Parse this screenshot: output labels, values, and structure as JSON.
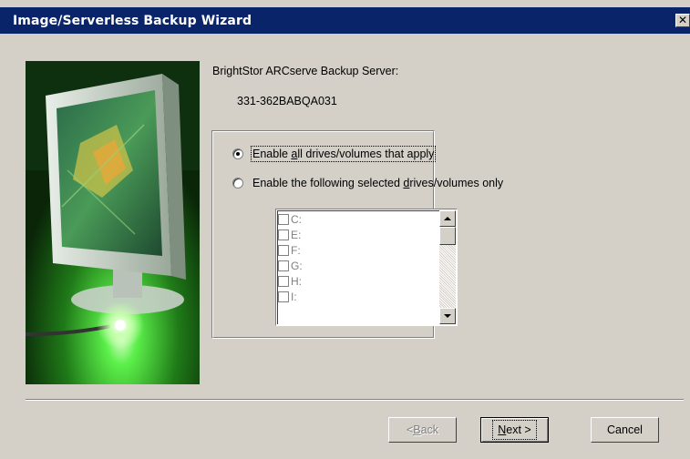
{
  "window": {
    "title": "Image/Serverless Backup Wizard",
    "close_glyph": "✕"
  },
  "server": {
    "label": "BrightStor ARCserve Backup Server:",
    "name": "331-362BABQA031"
  },
  "options": {
    "all": {
      "pre": "Enable ",
      "accel": "a",
      "post": "ll drives/volumes that apply",
      "checked": true
    },
    "selected": {
      "pre": "Enable the following selected ",
      "accel": "d",
      "post": "rives/volumes only",
      "checked": false
    }
  },
  "drives": [
    "C:",
    "E:",
    "F:",
    "G:",
    "H:",
    "I:"
  ],
  "buttons": {
    "back": {
      "pre": "< ",
      "accel": "B",
      "post": "ack"
    },
    "next": {
      "pre": "",
      "accel": "N",
      "post": "ext >"
    },
    "cancel": "Cancel"
  },
  "colors": {
    "titlebar": "#0a246a",
    "face": "#d4d0c8",
    "disabled_text": "#808080"
  },
  "icons": {
    "art": "monitor-illustration",
    "close": "close-icon",
    "scroll_up": "scroll-up-icon",
    "scroll_down": "scroll-down-icon"
  }
}
